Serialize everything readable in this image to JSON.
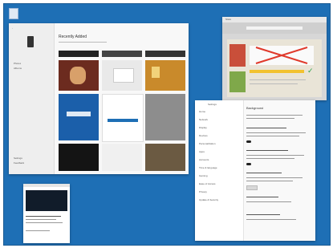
{
  "photos_window": {
    "title": "Recently Added",
    "side_items": [
      "Photos",
      "Albums"
    ],
    "bottom_items": [
      "Settings",
      "Feedback"
    ]
  },
  "settings_window": {
    "title": "Settings",
    "nav_items": [
      "Home",
      "Network",
      "Display",
      "Devices",
      "Personalization",
      "Apps",
      "Accounts",
      "Time & language",
      "Gaming",
      "Ease of Access",
      "Privacy",
      "Update & Security"
    ],
    "heading": "Background"
  },
  "store_window": {
    "title": "Store"
  },
  "browser_window": {
    "title": ""
  },
  "colors": {
    "desktop": "#1e6fb5",
    "accent": "#1e6fb5",
    "reject_mark": "#e0392b",
    "accept_mark": "#2aa34a",
    "highlight": "#f2c230"
  }
}
